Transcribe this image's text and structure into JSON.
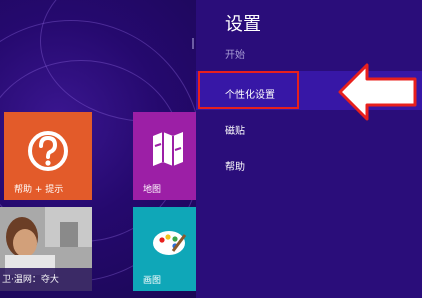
{
  "start_screen": {
    "tiles": [
      {
        "label": "帮助 + 提示",
        "icon": "question-circle-icon",
        "color": "#e35b2a"
      },
      {
        "label": "地图",
        "icon": "map-icon",
        "color": "#9c1fa6"
      },
      {
        "label": "卫·温网：夺大",
        "icon": "tennis-photo",
        "color": "#b7b7b7"
      },
      {
        "label": "画图",
        "icon": "paint-palette-icon",
        "color": "#0fa7b8"
      }
    ]
  },
  "settings_pane": {
    "title": "设置",
    "subtitle": "开始",
    "items": [
      {
        "label": "个性化设置",
        "highlighted": true
      },
      {
        "label": "磁贴",
        "highlighted": false
      },
      {
        "label": "帮助",
        "highlighted": false
      }
    ]
  },
  "annotation": {
    "highlight_color": "#e8201d",
    "arrow_direction": "left"
  }
}
